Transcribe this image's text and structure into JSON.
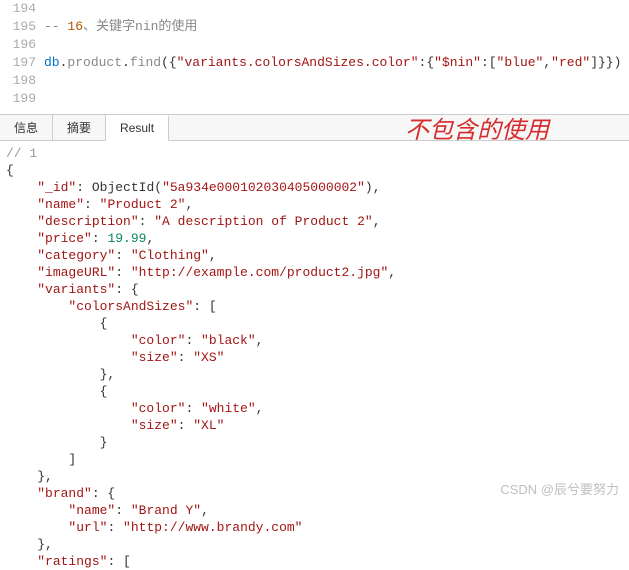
{
  "editor": {
    "lines": [
      {
        "num": "194",
        "frag": []
      },
      {
        "num": "195",
        "frag": [
          {
            "cls": "tok-comment",
            "t": "-- "
          },
          {
            "cls": "tok-num",
            "t": "16"
          },
          {
            "cls": "tok-comment",
            "t": "、关键字nin的使用"
          }
        ]
      },
      {
        "num": "196",
        "frag": []
      },
      {
        "num": "197",
        "frag": [
          {
            "cls": "tok-key",
            "t": "db"
          },
          {
            "cls": "tok-punc",
            "t": "."
          },
          {
            "cls": "tok-method",
            "t": "product"
          },
          {
            "cls": "tok-punc",
            "t": "."
          },
          {
            "cls": "tok-method",
            "t": "find"
          },
          {
            "cls": "tok-punc",
            "t": "({"
          },
          {
            "cls": "tok-str",
            "t": "\"variants.colorsAndSizes.color\""
          },
          {
            "cls": "tok-punc",
            "t": ":{"
          },
          {
            "cls": "tok-str",
            "t": "\"$nin\""
          },
          {
            "cls": "tok-punc",
            "t": ":["
          },
          {
            "cls": "tok-str",
            "t": "\"blue\""
          },
          {
            "cls": "tok-punc",
            "t": ","
          },
          {
            "cls": "tok-str",
            "t": "\"red\""
          },
          {
            "cls": "tok-punc",
            "t": "]}})"
          }
        ]
      },
      {
        "num": "198",
        "frag": []
      },
      {
        "num": "199",
        "frag": []
      }
    ]
  },
  "annotation": "不包含的使用",
  "tabs": {
    "items": [
      {
        "label": "信息",
        "active": false
      },
      {
        "label": "摘要",
        "active": false
      },
      {
        "label": "Result",
        "active": true
      }
    ]
  },
  "result_lines": [
    [
      {
        "cls": "r-comment",
        "t": "// 1"
      }
    ],
    [
      {
        "cls": "r-brace",
        "t": "{"
      }
    ],
    [
      {
        "cls": "",
        "t": "    "
      },
      {
        "cls": "r-key",
        "t": "\"_id\""
      },
      {
        "cls": "r-punc",
        "t": ": "
      },
      {
        "cls": "r-fn",
        "t": "ObjectId("
      },
      {
        "cls": "r-oid",
        "t": "\"5a934e000102030405000002\""
      },
      {
        "cls": "r-fn",
        "t": "),"
      }
    ],
    [
      {
        "cls": "",
        "t": "    "
      },
      {
        "cls": "r-key",
        "t": "\"name\""
      },
      {
        "cls": "r-punc",
        "t": ": "
      },
      {
        "cls": "r-str",
        "t": "\"Product 2\""
      },
      {
        "cls": "r-punc",
        "t": ","
      }
    ],
    [
      {
        "cls": "",
        "t": "    "
      },
      {
        "cls": "r-key",
        "t": "\"description\""
      },
      {
        "cls": "r-punc",
        "t": ": "
      },
      {
        "cls": "r-str",
        "t": "\"A description of Product 2\""
      },
      {
        "cls": "r-punc",
        "t": ","
      }
    ],
    [
      {
        "cls": "",
        "t": "    "
      },
      {
        "cls": "r-key",
        "t": "\"price\""
      },
      {
        "cls": "r-punc",
        "t": ": "
      },
      {
        "cls": "r-numv",
        "t": "19.99"
      },
      {
        "cls": "r-punc",
        "t": ","
      }
    ],
    [
      {
        "cls": "",
        "t": "    "
      },
      {
        "cls": "r-key",
        "t": "\"category\""
      },
      {
        "cls": "r-punc",
        "t": ": "
      },
      {
        "cls": "r-str",
        "t": "\"Clothing\""
      },
      {
        "cls": "r-punc",
        "t": ","
      }
    ],
    [
      {
        "cls": "",
        "t": "    "
      },
      {
        "cls": "r-key",
        "t": "\"imageURL\""
      },
      {
        "cls": "r-punc",
        "t": ": "
      },
      {
        "cls": "r-str",
        "t": "\"http://example.com/product2.jpg\""
      },
      {
        "cls": "r-punc",
        "t": ","
      }
    ],
    [
      {
        "cls": "",
        "t": "    "
      },
      {
        "cls": "r-key",
        "t": "\"variants\""
      },
      {
        "cls": "r-punc",
        "t": ": {"
      }
    ],
    [
      {
        "cls": "",
        "t": "        "
      },
      {
        "cls": "r-key",
        "t": "\"colorsAndSizes\""
      },
      {
        "cls": "r-punc",
        "t": ": ["
      }
    ],
    [
      {
        "cls": "",
        "t": "            {"
      }
    ],
    [
      {
        "cls": "",
        "t": "                "
      },
      {
        "cls": "r-key",
        "t": "\"color\""
      },
      {
        "cls": "r-punc",
        "t": ": "
      },
      {
        "cls": "r-str",
        "t": "\"black\""
      },
      {
        "cls": "r-punc",
        "t": ","
      }
    ],
    [
      {
        "cls": "",
        "t": "                "
      },
      {
        "cls": "r-key",
        "t": "\"size\""
      },
      {
        "cls": "r-punc",
        "t": ": "
      },
      {
        "cls": "r-str",
        "t": "\"XS\""
      }
    ],
    [
      {
        "cls": "",
        "t": "            },"
      }
    ],
    [
      {
        "cls": "",
        "t": "            {"
      }
    ],
    [
      {
        "cls": "",
        "t": "                "
      },
      {
        "cls": "r-key",
        "t": "\"color\""
      },
      {
        "cls": "r-punc",
        "t": ": "
      },
      {
        "cls": "r-str",
        "t": "\"white\""
      },
      {
        "cls": "r-punc",
        "t": ","
      }
    ],
    [
      {
        "cls": "",
        "t": "                "
      },
      {
        "cls": "r-key",
        "t": "\"size\""
      },
      {
        "cls": "r-punc",
        "t": ": "
      },
      {
        "cls": "r-str",
        "t": "\"XL\""
      }
    ],
    [
      {
        "cls": "",
        "t": "            }"
      }
    ],
    [
      {
        "cls": "",
        "t": "        ]"
      }
    ],
    [
      {
        "cls": "",
        "t": "    },"
      }
    ],
    [
      {
        "cls": "",
        "t": "    "
      },
      {
        "cls": "r-key",
        "t": "\"brand\""
      },
      {
        "cls": "r-punc",
        "t": ": {"
      }
    ],
    [
      {
        "cls": "",
        "t": "        "
      },
      {
        "cls": "r-key",
        "t": "\"name\""
      },
      {
        "cls": "r-punc",
        "t": ": "
      },
      {
        "cls": "r-str",
        "t": "\"Brand Y\""
      },
      {
        "cls": "r-punc",
        "t": ","
      }
    ],
    [
      {
        "cls": "",
        "t": "        "
      },
      {
        "cls": "r-key",
        "t": "\"url\""
      },
      {
        "cls": "r-punc",
        "t": ": "
      },
      {
        "cls": "r-str",
        "t": "\"http://www.brandy.com\""
      }
    ],
    [
      {
        "cls": "",
        "t": "    },"
      }
    ],
    [
      {
        "cls": "",
        "t": "    "
      },
      {
        "cls": "r-key",
        "t": "\"ratings\""
      },
      {
        "cls": "r-punc",
        "t": ": ["
      }
    ]
  ],
  "watermark": "CSDN @辰兮要努力"
}
